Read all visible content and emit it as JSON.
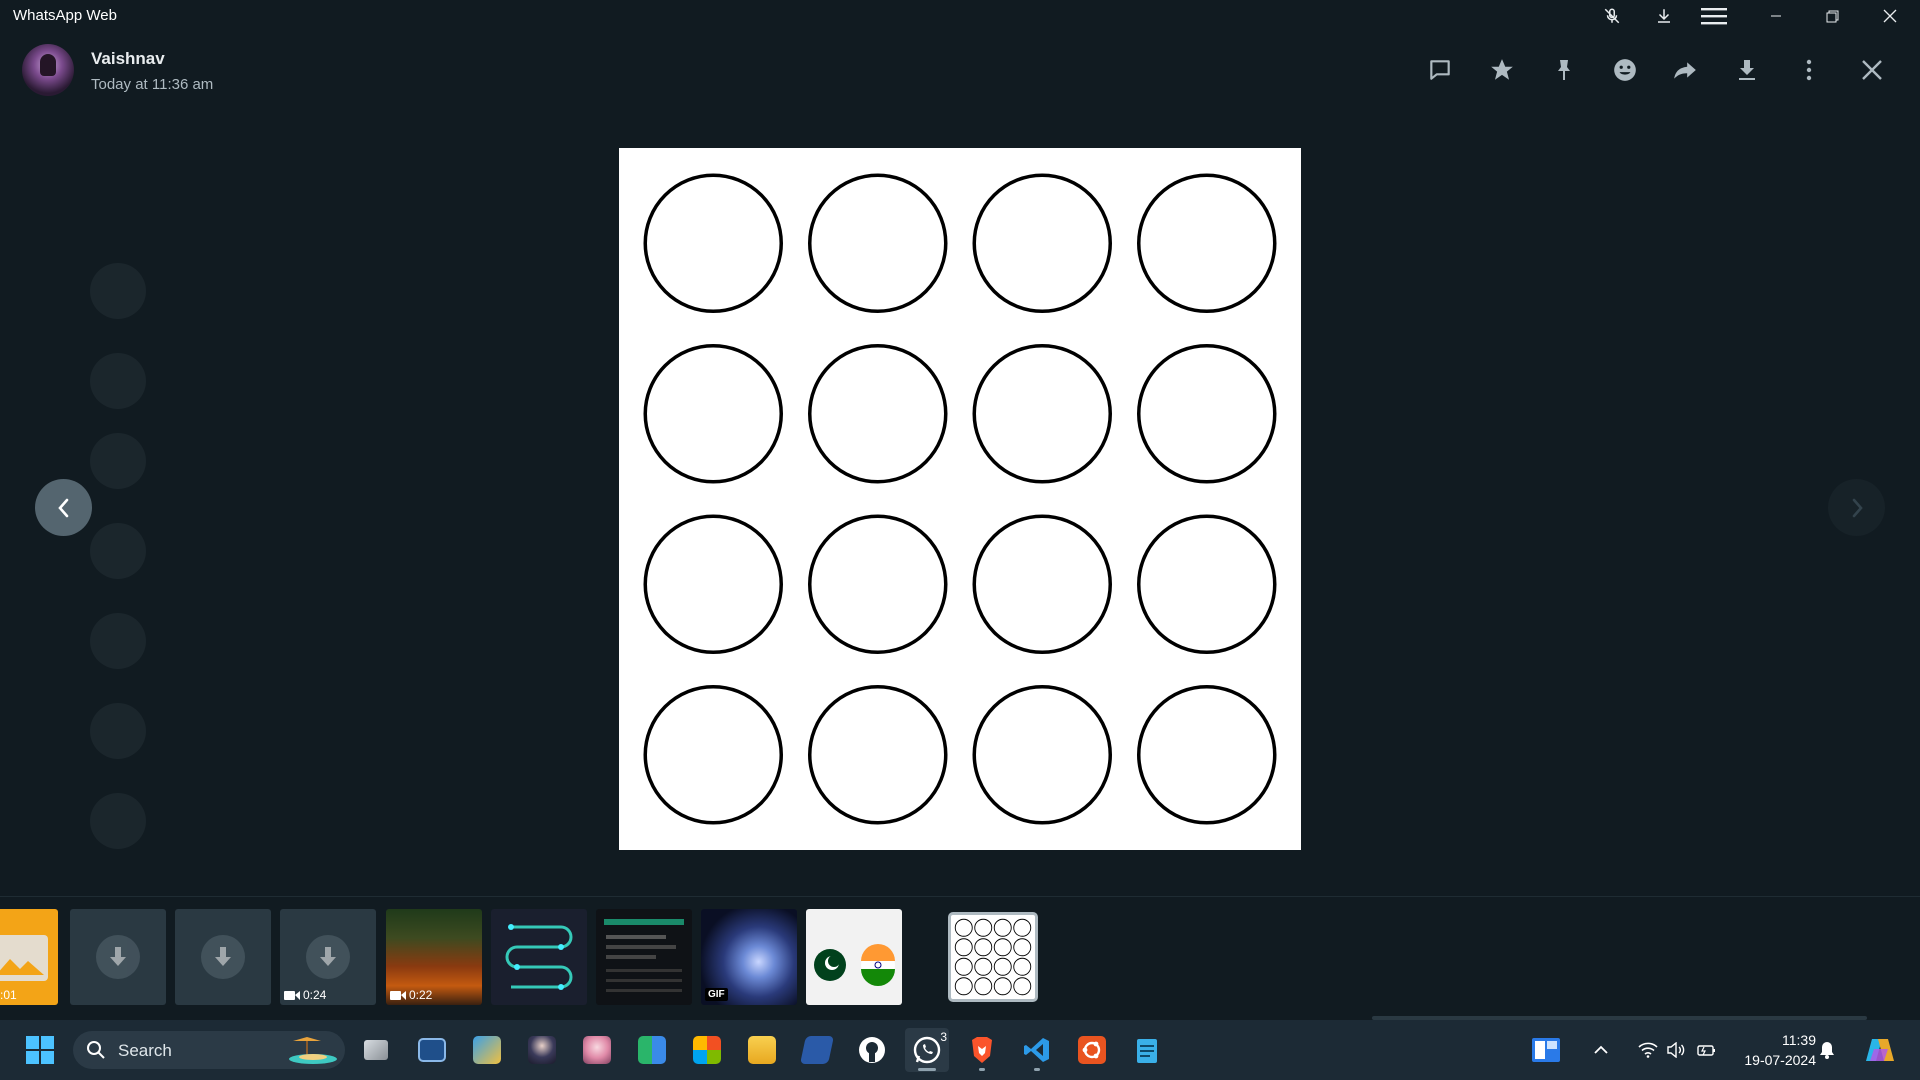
{
  "window": {
    "title": "WhatsApp Web"
  },
  "sender": {
    "name": "Vaishnav",
    "timestamp": "Today at 11:36 am"
  },
  "toolbar_icons": [
    "reply-icon",
    "star-icon",
    "pin-icon",
    "react-icon",
    "forward-icon",
    "download-icon",
    "more-options-icon",
    "close-icon"
  ],
  "titlebar_icons": [
    "mute-icon",
    "download-icon",
    "menu-icon",
    "minimize-icon",
    "restore-icon",
    "close-icon"
  ],
  "thumbnails": [
    {
      "kind": "image",
      "duration": ":01"
    },
    {
      "kind": "download"
    },
    {
      "kind": "download"
    },
    {
      "kind": "video-download",
      "duration": "0:24"
    },
    {
      "kind": "video",
      "duration": "0:22"
    },
    {
      "kind": "image"
    },
    {
      "kind": "image"
    },
    {
      "kind": "gif",
      "label": "GIF"
    },
    {
      "kind": "image"
    },
    {
      "kind": "image",
      "selected": true
    }
  ],
  "media": {
    "grid_rows": 4,
    "grid_cols": 4,
    "shape": "circle"
  },
  "taskbar": {
    "search_label": "Search",
    "whatsapp_badge": "3",
    "time": "11:39",
    "date": "19-07-2024"
  },
  "colors": {
    "background": "#111b21",
    "accent": "#00a884",
    "nav_button": "#54656f"
  }
}
